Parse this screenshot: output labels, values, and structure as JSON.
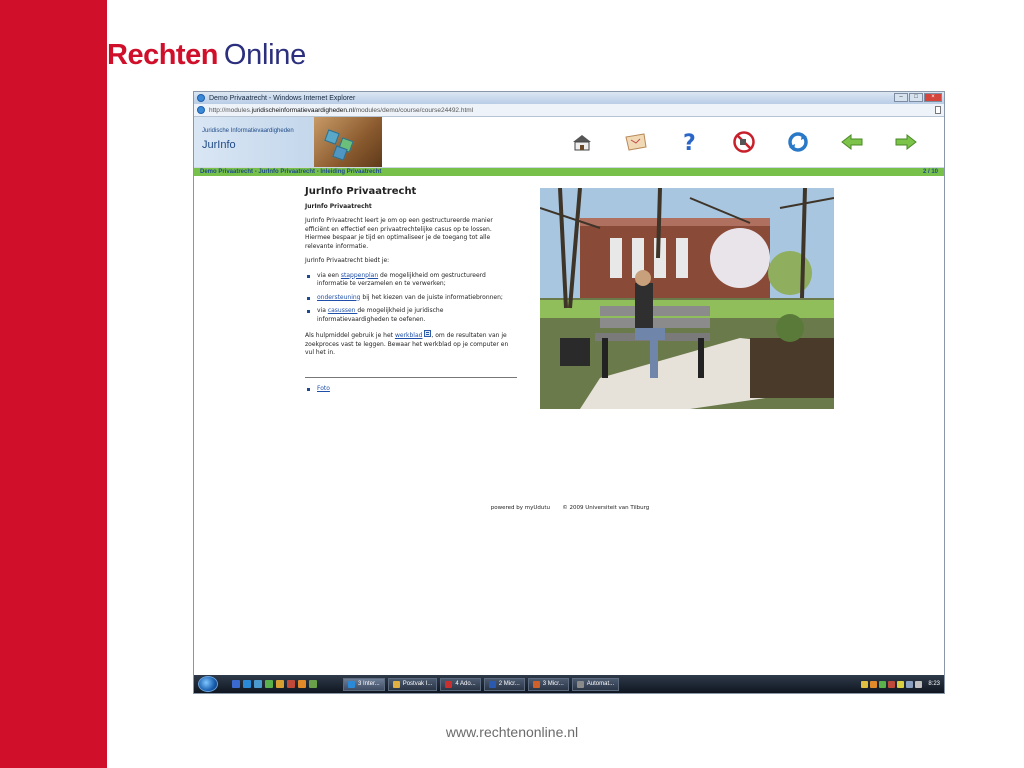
{
  "slide": {
    "logo_red": "Rechten",
    "logo_blue": "Online",
    "footer_url": "www.rechtenonline.nl",
    "colors": {
      "red": "#d0102a",
      "navy": "#2b2f7d"
    }
  },
  "browser": {
    "window_title": "Demo Privaatrecht - Windows Internet Explorer",
    "address_prefix": "http://modules.",
    "address_host": "juridischeinformatievaardigheden.nl",
    "address_path": "/modules/demo/course/course24492.html"
  },
  "header": {
    "banner_subtitle": "Juridische Informatievaardigheden",
    "banner_title": "JurInfo",
    "toolbar_icons": [
      "home-icon",
      "map-icon",
      "help-icon",
      "stop-icon",
      "refresh-icon",
      "back-arrow-icon",
      "forward-arrow-icon"
    ]
  },
  "navstrip": {
    "breadcrumb": "Demo Privaatrecht - JurInfo Privaatrecht - Inleiding Privaatrecht",
    "page_counter": "2 / 10",
    "color": "#77c04a"
  },
  "article": {
    "title": "JurInfo Privaatrecht",
    "subtitle": "JurInfo Privaatrecht",
    "intro": "JurInfo Privaatrecht leert je om op een gestructureerde manier efficiënt en effectief een privaatrechtelijke casus op te lossen. Hiermee bespaar je tijd en optimaliseer je de toegang tot alle relevante informatie.",
    "offers": "JurInfo Privaatrecht biedt je:",
    "items": [
      {
        "pre": "via een ",
        "link": "stappenplan",
        "post": " de mogelijkheid om gestructureerd informatie te verzamelen en te verwerken;"
      },
      {
        "pre": "",
        "link": "ondersteuning",
        "post": " bij het kiezen van de juiste informatiebronnen;"
      },
      {
        "pre": "via ",
        "link": "casussen ",
        "post": "de mogelijkheid je juridische informatievaardigheden te oefenen."
      }
    ],
    "help_pre": "Als hulpmiddel gebruik je het ",
    "help_link": "werkblad",
    "help_post": ", om de resultaten van je zoekproces vast te leggen. Bewaar het werkblad op je computer en vul het in.",
    "foto_link": "Foto"
  },
  "credits": {
    "powered": "powered by myUdutu",
    "copyright": "© 2009 Universiteit van Tilburg"
  },
  "taskbar": {
    "tasks": [
      "3 Inter...",
      "Postvak I...",
      "4 Ado...",
      "2 Micr...",
      "3 Micr...",
      "Automat..."
    ],
    "clock": "8:23"
  }
}
